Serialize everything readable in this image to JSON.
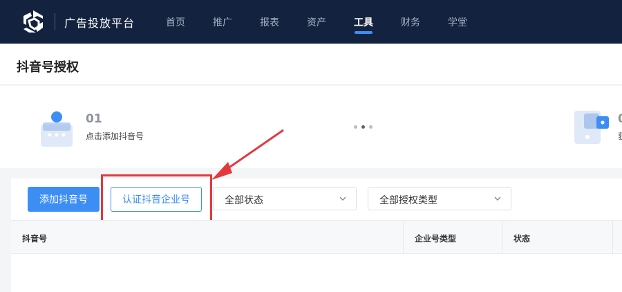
{
  "app": {
    "brand": "广告投放平台"
  },
  "nav": {
    "items": [
      {
        "label": "首页",
        "active": false
      },
      {
        "label": "推广",
        "active": false
      },
      {
        "label": "报表",
        "active": false
      },
      {
        "label": "资产",
        "active": false
      },
      {
        "label": "工具",
        "active": true
      },
      {
        "label": "财务",
        "active": false
      },
      {
        "label": "学堂",
        "active": false
      }
    ]
  },
  "page": {
    "title": "抖音号授权"
  },
  "steps": [
    {
      "num": "01",
      "desc": "点击添加抖音号"
    },
    {
      "num": "0",
      "desc": "获"
    }
  ],
  "toolbar": {
    "add_label": "添加抖音号",
    "verify_label": "认证抖音企业号",
    "status_filter": "全部状态",
    "auth_type_filter": "全部授权类型"
  },
  "table": {
    "columns": [
      "抖音号",
      "企业号类型",
      "状态"
    ]
  },
  "colors": {
    "nav_bg": "#13233f",
    "accent": "#3c8ef5",
    "annotation_red": "#e4393c"
  }
}
